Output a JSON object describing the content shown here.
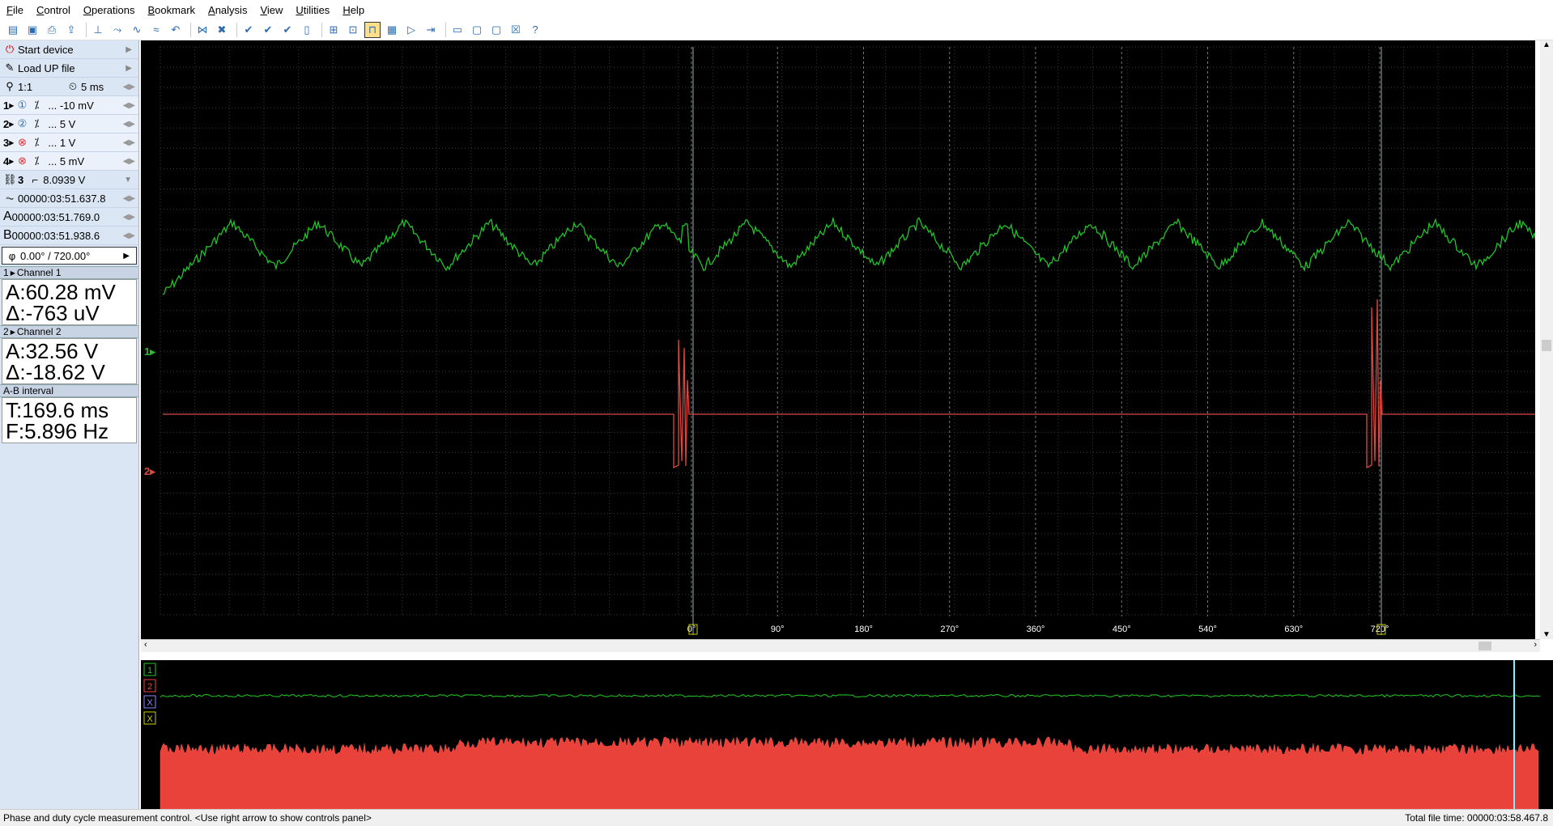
{
  "menu": [
    "File",
    "Control",
    "Operations",
    "Bookmark",
    "Analysis",
    "View",
    "Utilities",
    "Help"
  ],
  "side": {
    "start_device": "Start device",
    "load_file": "Load UP file",
    "zoom": "1:1",
    "timebase": "5 ms",
    "channels": [
      {
        "num": "1",
        "value": "... -10 mV"
      },
      {
        "num": "2",
        "value": "... 5 V"
      },
      {
        "num": "3",
        "value": "... 1 V"
      },
      {
        "num": "4",
        "value": "... 5 mV"
      }
    ],
    "trigger_channel": "3",
    "trigger_level": "8.0939 V",
    "time_pos": "00000:03:51.637.8",
    "cursor_a_label": "A",
    "cursor_a": "00000:03:51.769.0",
    "cursor_b_label": "B",
    "cursor_b": "00000:03:51.938.6",
    "phase": "0.00° / 720.00°",
    "ch1_header": "Channel 1",
    "ch1_a": "A:60.28 mV",
    "ch1_d": "Δ:-763 uV",
    "ch2_header": "Channel 2",
    "ch2_a": "A:32.56 V",
    "ch2_d": "Δ:-18.62 V",
    "ab_header": "A-B interval",
    "ab_t": "T:169.6 ms",
    "ab_f": "F:5.896 Hz"
  },
  "scope": {
    "ch1_marker": "1",
    "ch2_marker": "2",
    "phase_ticks": [
      "0°",
      "90°",
      "180°",
      "270°",
      "360°",
      "450°",
      "540°",
      "630°",
      "720°"
    ],
    "colors": {
      "ch1": "#22c22a",
      "ch2": "#e0473f",
      "grid": "#3a3a3a",
      "cursor": "#9aa"
    }
  },
  "overview": {
    "markers": [
      "1",
      "2",
      "X",
      "X"
    ]
  },
  "status": {
    "left": "Phase and duty cycle measurement control. <Use right arrow to show controls panel>",
    "right": "Total file time: 00000:03:58.467.8"
  }
}
